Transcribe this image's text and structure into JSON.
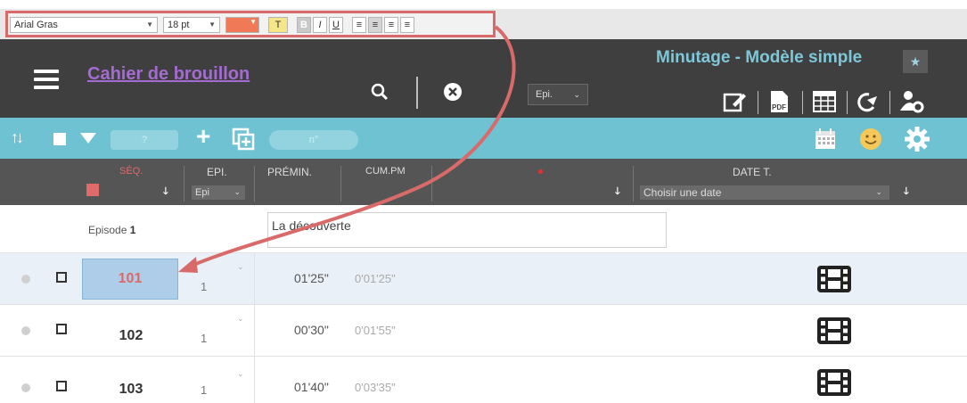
{
  "format_toolbar": {
    "font_name": "Arial Gras",
    "font_size": "18 pt",
    "highlight_label": "T",
    "bold_label": "B",
    "italic_label": "I",
    "underline_label": "U",
    "text_color": "#f07a57",
    "highlight_color": "#f6e68a",
    "frame_color": "#d96a6a"
  },
  "header": {
    "doc_title": "Cahier de brouillon",
    "app_title": "Minutage - Modèle simple",
    "epi_select": "Epi.",
    "icons": [
      "menu-icon",
      "search-icon",
      "clear-icon",
      "edit-icon",
      "pdf-icon",
      "table-icon",
      "share-icon",
      "user-settings-icon",
      "star-icon"
    ]
  },
  "toolbar": {
    "seq_input_placeholder": "?",
    "number_input_placeholder": "n°",
    "icons": [
      "sort-arrows-icon",
      "checkbox-icon",
      "triangle-down-icon",
      "add-icon",
      "duplicate-icon",
      "calendar-icon",
      "smiley-icon",
      "gear-icon"
    ]
  },
  "grid_header": {
    "seq": "SÉQ.",
    "epi": "EPI.",
    "epi_select": "Epi",
    "premin": "PRÉMIN.",
    "cumpm": "CUM.PM",
    "date": "DATE T.",
    "date_select": "Choisir une date"
  },
  "episode": {
    "label": "Episode",
    "number": "1",
    "title": "La découverte"
  },
  "rows": [
    {
      "num": "101",
      "epi": "1",
      "premin": "01'25\"",
      "cumpm": "0'01'25\"",
      "selected": true
    },
    {
      "num": "102",
      "epi": "1",
      "premin": "00'30\"",
      "cumpm": "0'01'55\"",
      "selected": false
    },
    {
      "num": "103",
      "epi": "1",
      "premin": "01'40\"",
      "cumpm": "0'03'35\"",
      "selected": false
    }
  ]
}
